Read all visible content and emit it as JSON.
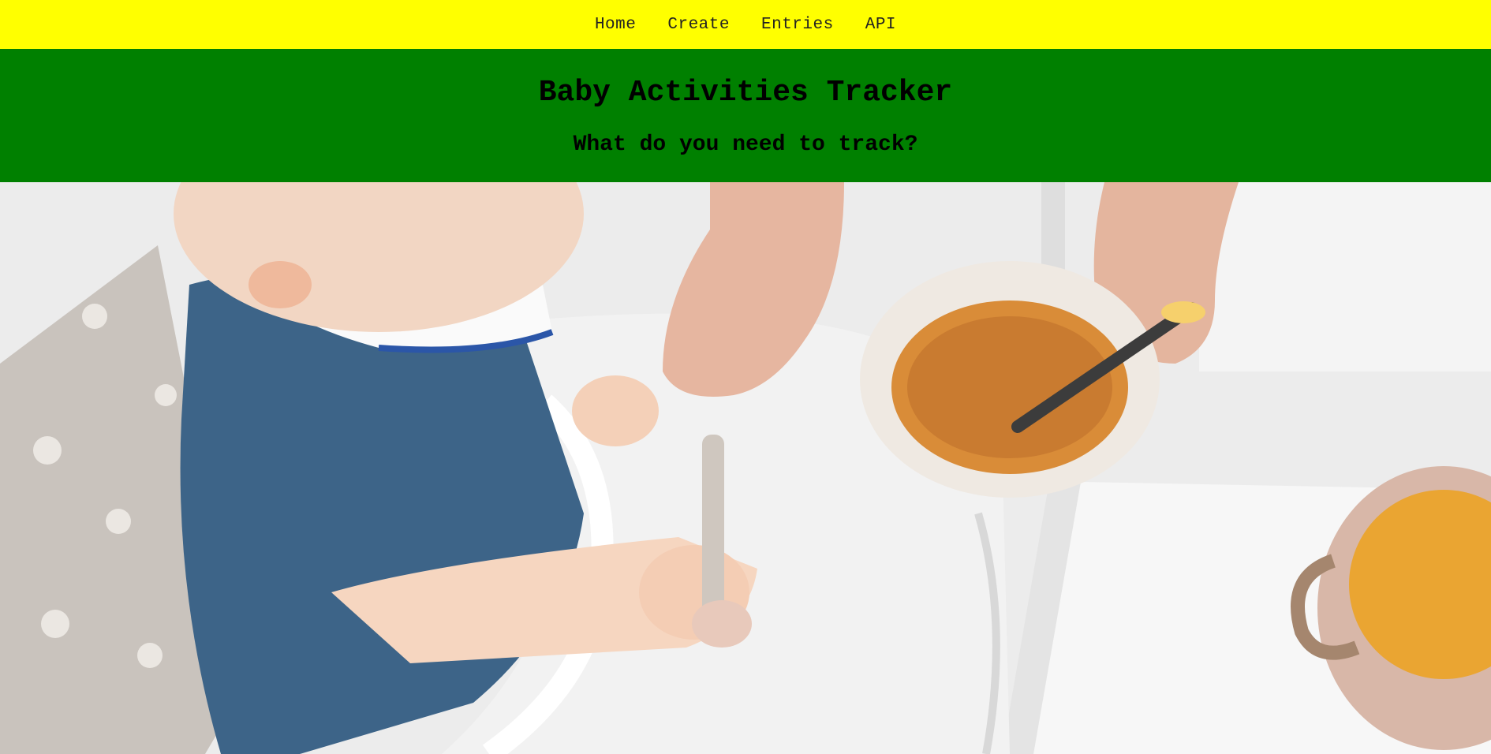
{
  "nav": {
    "items": [
      {
        "label": "Home"
      },
      {
        "label": "Create"
      },
      {
        "label": "Entries"
      },
      {
        "label": "API"
      }
    ]
  },
  "header": {
    "title": "Baby Activities Tracker",
    "subtitle": "What do you need to track?"
  },
  "colors": {
    "nav_bg": "#ffff00",
    "header_bg": "#008000",
    "text": "#000000"
  },
  "hero": {
    "icon": "baby-feeding-photo"
  }
}
